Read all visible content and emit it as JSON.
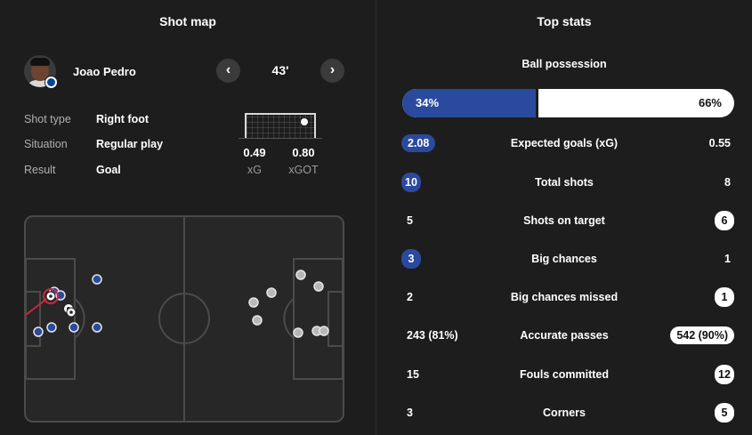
{
  "shot_map": {
    "title": "Shot map",
    "player_name": "Joao Pedro",
    "minute": "43'",
    "prev_label": "‹",
    "next_label": "›",
    "details": [
      {
        "label": "Shot type",
        "value": "Right foot"
      },
      {
        "label": "Situation",
        "value": "Regular play"
      },
      {
        "label": "Result",
        "value": "Goal"
      }
    ],
    "xg": {
      "value": "0.49",
      "label": "xG"
    },
    "xgot": {
      "value": "0.80",
      "label": "xGOT"
    },
    "colors": {
      "home_shot": "#2b4a9e",
      "away_shot": "#b8b8b8",
      "selected_ring": "#d0263a"
    }
  },
  "top_stats": {
    "title": "Top stats",
    "possession": {
      "label": "Ball possession",
      "home": "34%",
      "away": "66%",
      "home_fraction": 0.34
    },
    "colors": {
      "home": "#2b4a9e",
      "away": "#ffffff"
    },
    "rows": [
      {
        "name": "Expected goals (xG)",
        "home": "2.08",
        "away": "0.55",
        "highlight": "home"
      },
      {
        "name": "Total shots",
        "home": "10",
        "away": "8",
        "highlight": "home"
      },
      {
        "name": "Shots on target",
        "home": "5",
        "away": "6",
        "highlight": "away"
      },
      {
        "name": "Big chances",
        "home": "3",
        "away": "1",
        "highlight": "home"
      },
      {
        "name": "Big chances missed",
        "home": "2",
        "away": "1",
        "highlight": "away"
      },
      {
        "name": "Accurate passes",
        "home": "243 (81%)",
        "away": "542 (90%)",
        "highlight": "away"
      },
      {
        "name": "Fouls committed",
        "home": "15",
        "away": "12",
        "highlight": "away"
      },
      {
        "name": "Corners",
        "home": "3",
        "away": "5",
        "highlight": "away"
      }
    ]
  }
}
